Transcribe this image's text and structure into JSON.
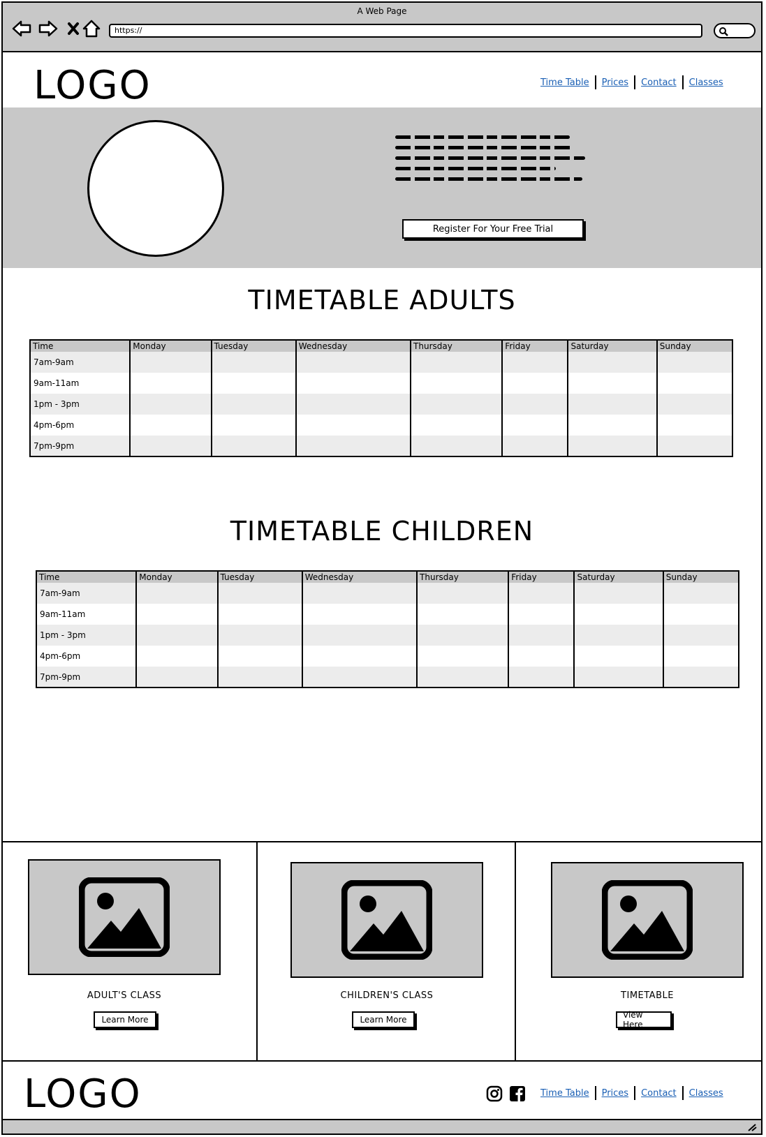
{
  "browser": {
    "title": "A Web Page",
    "url": "https://"
  },
  "header": {
    "logo": "LOGO",
    "nav": [
      "Time Table",
      "Prices",
      "Contact",
      "Classes"
    ]
  },
  "hero": {
    "cta_label": "Register For Your Free Trial"
  },
  "timetable_adults": {
    "title": "TIMETABLE ADULTS",
    "columns": [
      "Time",
      "Monday",
      "Tuesday",
      "Wednesday",
      "Thursday",
      "Friday",
      "Saturday",
      "Sunday"
    ],
    "rows": [
      "7am-9am",
      "9am-11am",
      "1pm - 3pm",
      "4pm-6pm",
      "7pm-9pm"
    ]
  },
  "timetable_children": {
    "title": "TIMETABLE CHILDREN",
    "columns": [
      "Time",
      "Monday",
      "Tuesday",
      "Wednesday",
      "Thursday",
      "Friday",
      "Saturday",
      "Sunday"
    ],
    "rows": [
      "7am-9am",
      "9am-11am",
      "1pm - 3pm",
      "4pm-6pm",
      "7pm-9pm"
    ]
  },
  "cards": [
    {
      "caption": "ADULT'S CLASS",
      "button": "Learn More",
      "icon": "image-placeholder-icon"
    },
    {
      "caption": "CHILDREN'S CLASS",
      "button": "Learn More",
      "icon": "image-placeholder-icon"
    },
    {
      "caption": "TIMETABLE",
      "button": "View Here",
      "icon": "image-placeholder-icon"
    }
  ],
  "footer": {
    "logo": "LOGO",
    "social": [
      "instagram-icon",
      "facebook-icon"
    ],
    "nav": [
      "Time Table",
      "Prices",
      "Contact",
      "Classes"
    ]
  },
  "colors": {
    "chrome": "#c8c8c8",
    "link": "#1a5fb4",
    "row_alt": "#ececec"
  }
}
